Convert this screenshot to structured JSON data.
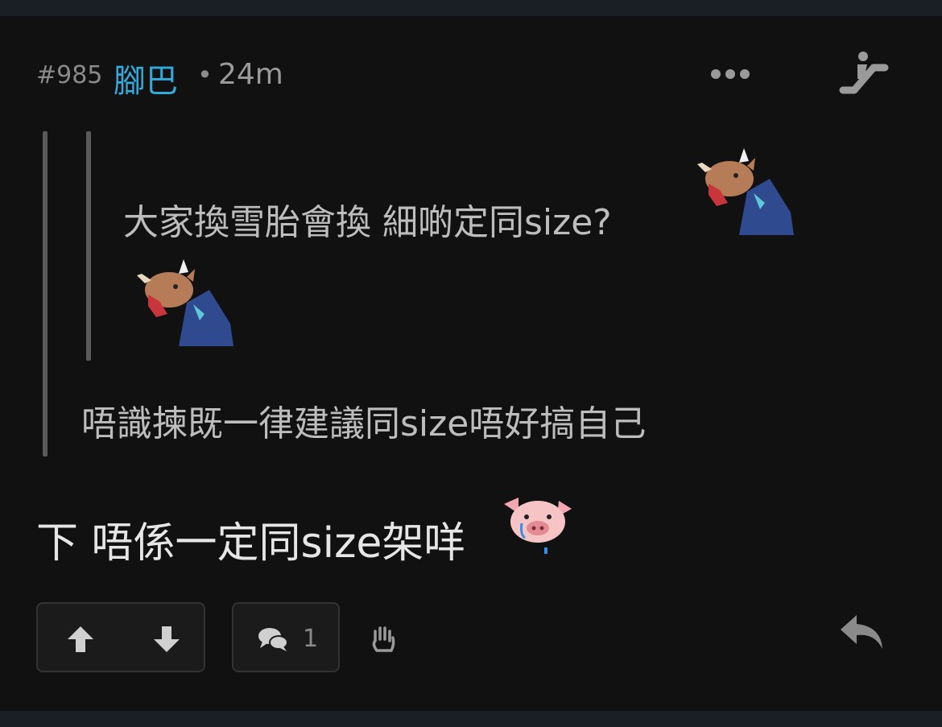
{
  "post": {
    "number": "#985",
    "username": "腳巴",
    "separator": "•",
    "time": "24m"
  },
  "quote": {
    "inner_text": "大家換雪胎會換 細啲定同size?",
    "outer_text": "唔識揀既一律建議同size唔好搞自己"
  },
  "reply": {
    "text": "下 唔係一定同size架咩"
  },
  "actions": {
    "comment_count": "1"
  },
  "icons": {
    "more": "more-dots-icon",
    "escalator": "escalator-icon",
    "upvote": "arrow-up-icon",
    "downvote": "arrow-down-icon",
    "comments": "chat-bubbles-icon",
    "block": "hand-icon",
    "reply": "reply-arrow-icon"
  },
  "colors": {
    "username": "#34aadc",
    "background": "#111111"
  }
}
